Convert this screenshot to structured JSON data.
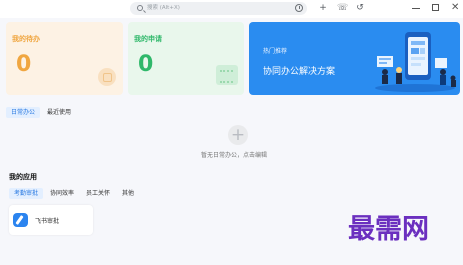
{
  "titlebar": {
    "search_placeholder": "搜索 (Alt+X)",
    "add_icon": "+",
    "phone_icon": "☏",
    "history_icon": "↺",
    "close_icon": "✕"
  },
  "cards": {
    "todo": {
      "title": "我的待办",
      "count": "0"
    },
    "apply": {
      "title": "我的申请",
      "count": "0"
    },
    "banner": {
      "subtitle": "热门推荐",
      "title": "协同办公解决方案"
    }
  },
  "tabs_top": [
    {
      "label": "日常办公",
      "active": true
    },
    {
      "label": "最近使用",
      "active": false
    }
  ],
  "empty_state": {
    "icon": "+",
    "text": "暂无日常办公，点击编辑"
  },
  "my_apps": {
    "title": "我的应用",
    "tabs": [
      {
        "label": "考勤审批",
        "active": true
      },
      {
        "label": "协同效率",
        "active": false
      },
      {
        "label": "员工关怀",
        "active": false
      },
      {
        "label": "其他",
        "active": false
      }
    ],
    "apps": [
      {
        "label": "飞书审批",
        "icon": "feishu-approval-icon"
      }
    ]
  },
  "watermark": "最需网",
  "colors": {
    "accent": "#2a8cf0",
    "todo": "#f0a640",
    "apply": "#2fb86a",
    "watermark": "#6b2fbf"
  }
}
